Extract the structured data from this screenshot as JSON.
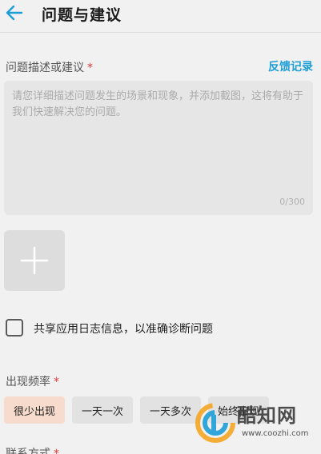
{
  "header": {
    "title": "问题与建议"
  },
  "description": {
    "label": "问题描述或建议",
    "required_mark": "*",
    "feedback_link": "反馈记录",
    "placeholder": "请您详细描述问题发生的场景和现象，并添加截图，这将有助于我们快速解决您的问题。",
    "counter": "0/300"
  },
  "share_log": {
    "label": "共享应用日志信息，以准确诊断问题",
    "checked": false
  },
  "frequency": {
    "label": "出现频率",
    "required_mark": "*",
    "options": [
      "很少出现",
      "一天一次",
      "一天多次",
      "始终出现"
    ],
    "selected": "很少出现"
  },
  "contact": {
    "label": "联系方式",
    "required_mark": "*"
  },
  "watermark": {
    "brand": "酷知网",
    "url": "www.coozhi.com"
  },
  "colors": {
    "accent": "#1e9ed8",
    "selected_chip": "#f7dccd",
    "required": "#e53935"
  }
}
